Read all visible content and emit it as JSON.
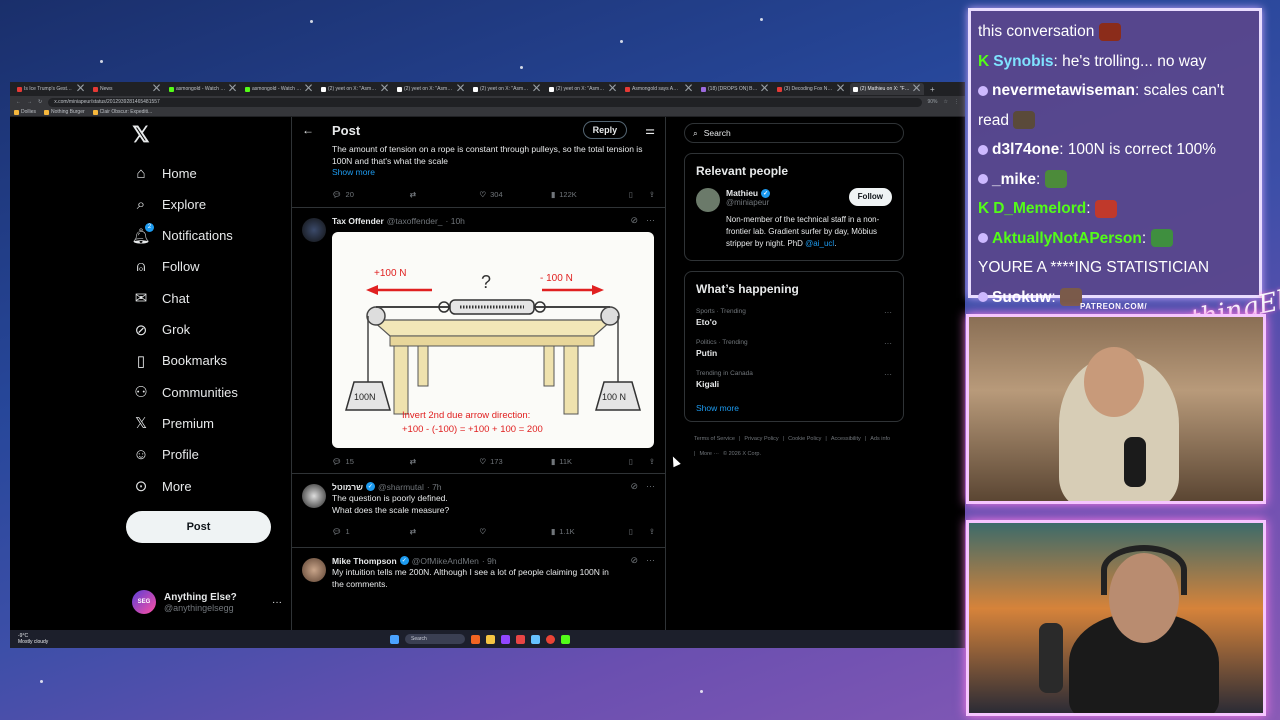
{
  "browser": {
    "tabs": [
      {
        "label": "Is Ice Trump's Gestapo?",
        "fav": "red",
        "active": false
      },
      {
        "label": "News",
        "fav": "red",
        "active": false
      },
      {
        "label": "asmongold - Watch the Y",
        "fav": "green",
        "active": false
      },
      {
        "label": "asmongold - Watch the Y",
        "fav": "green",
        "active": false
      },
      {
        "label": "(2) yeet on X: \"Asmongold",
        "fav": "x",
        "active": false
      },
      {
        "label": "(2) yeet on X: \"Asmongold",
        "fav": "x",
        "active": false
      },
      {
        "label": "(2) yeet on X: \"Asmongold",
        "fav": "x",
        "active": false
      },
      {
        "label": "(2) yeet on X: \"Asmongold",
        "fav": "x",
        "active": false
      },
      {
        "label": "Asmongold says America",
        "fav": "red",
        "active": false
      },
      {
        "label": "(18) [DROPS ON] BIG DA",
        "fav": "purple",
        "active": false
      },
      {
        "label": "(3) Decoding Fox News o",
        "fav": "red",
        "active": false
      },
      {
        "label": "(2) Mathieu on X: \"For m",
        "fav": "x",
        "active": true
      }
    ],
    "url": "x.com/miniapeur/status/2012939281465481557",
    "zoom": "90%",
    "bookmarks": [
      "Dollies",
      "Nothing Burger",
      "Clair Obscur: Expediti..."
    ]
  },
  "nav": {
    "items": [
      {
        "label": "Home",
        "icon": "home-icon",
        "glyph": "⌂"
      },
      {
        "label": "Explore",
        "icon": "search-icon",
        "glyph": "⌕"
      },
      {
        "label": "Notifications",
        "icon": "bell-icon",
        "glyph": "🔔︎",
        "badge": "2"
      },
      {
        "label": "Follow",
        "icon": "add-person-icon",
        "glyph": "⍝"
      },
      {
        "label": "Chat",
        "icon": "envelope-icon",
        "glyph": "✉"
      },
      {
        "label": "Grok",
        "icon": "grok-icon",
        "glyph": "⊘"
      },
      {
        "label": "Bookmarks",
        "icon": "bookmark-icon",
        "glyph": "▯"
      },
      {
        "label": "Communities",
        "icon": "communities-icon",
        "glyph": "⚇"
      },
      {
        "label": "Premium",
        "icon": "x-logo-icon",
        "glyph": "𝕏"
      },
      {
        "label": "Profile",
        "icon": "person-icon",
        "glyph": "☺"
      },
      {
        "label": "More",
        "icon": "more-circle-icon",
        "glyph": "⊙"
      }
    ],
    "post_label": "Post",
    "account": {
      "name": "Anything Else?",
      "handle": "@anythingelsegg",
      "avatar_text": "SEG"
    }
  },
  "main": {
    "title": "Post",
    "reply_label": "Reply",
    "top_tweet": {
      "text": "The amount of tension on a rope is constant through pulleys, so the total tension is 100N and that's what the scale",
      "show_more": "Show more",
      "replies": "20",
      "likes": "304",
      "views": "122K"
    },
    "tweets": [
      {
        "name": "Tax Offender",
        "handle": "@taxoffender_",
        "time": "· 10h",
        "image": {
          "left_label": "+100 N",
          "right_label": "- 100 N",
          "question": "?",
          "left_weight": "100N",
          "right_weight": "100 N",
          "caption_line1": "Invert 2nd due arrow direction:",
          "caption_line2": "+100 - (-100) = +100 + 100 = 200"
        },
        "replies": "15",
        "likes": "173",
        "views": "11K"
      },
      {
        "name": "שרמוטל",
        "handle": "@sharmutal",
        "time": "· 7h",
        "text1": "The question is poorly defined.",
        "text2": "What does the scale measure?",
        "replies": "1",
        "likes": "",
        "views": "1.1K"
      },
      {
        "name": "Mike Thompson",
        "handle": "@OfMikeAndMen",
        "time": "· 9h",
        "text1": "My intuition tells me 200N. Although I see a lot of people claiming 100N in",
        "text2": "the comments."
      }
    ]
  },
  "right": {
    "search_placeholder": "Search",
    "relevant_title": "Relevant people",
    "person": {
      "name": "Mathieu",
      "handle": "@miniapeur",
      "follow": "Follow",
      "bio": "Non-member of the technical staff in a non-frontier lab. Gradient surfer by day, Möbius stripper by night. PhD",
      "bio_link": "@ai_ucl",
      "bio_end": "."
    },
    "happening_title": "What’s happening",
    "trends": [
      {
        "context": "Sports · Trending",
        "name": "Eto'o"
      },
      {
        "context": "Politics · Trending",
        "name": "Putin"
      },
      {
        "context": "Trending in Canada",
        "name": "Kigali"
      }
    ],
    "show_more": "Show more",
    "footer": [
      "Terms of Service",
      "|",
      "Privacy Policy",
      "|",
      "Cookie Policy",
      "|",
      "Accessibility",
      "|",
      "Ads info",
      "|",
      "More ···",
      "© 2026 X Corp."
    ]
  },
  "taskbar": {
    "temp": "-9°C",
    "weather": "Mostly cloudy",
    "search": "Search"
  },
  "stream": {
    "patreon": "PATREON.COM/",
    "brand": "AnythingElse?",
    "chat": [
      {
        "user": "",
        "msg": "this conversation",
        "badge": "none",
        "color": "#ffffff"
      },
      {
        "user": "Synobis",
        "msg": ": he's trolling... no way",
        "badge": "kick",
        "color": "#7fe3ff"
      },
      {
        "user": "nevermetawiseman",
        "msg": ": scales can't",
        "badge": "dot",
        "color": "#ffffff"
      },
      {
        "user": "",
        "msg": "read",
        "badge": "none",
        "color": "#ffffff"
      },
      {
        "user": "d3l74one",
        "msg": ": 100N is correct 100%",
        "badge": "dot",
        "color": "#ffffff"
      },
      {
        "user": "_mike",
        "msg": ":",
        "badge": "dot",
        "color": "#ffffff"
      },
      {
        "user": "D_Memelord",
        "msg": ":",
        "badge": "kick",
        "color": "#53fc18"
      },
      {
        "user": "AktuallyNotAPerson",
        "msg": ":",
        "badge": "dot",
        "color": "#53fc18"
      },
      {
        "user": "",
        "msg": "YOURE A ****ING STATISTICIAN",
        "badge": "none",
        "color": "#ffffff"
      },
      {
        "user": "Suokuw",
        "msg": ":",
        "badge": "dot",
        "color": "#ffffff"
      }
    ]
  }
}
